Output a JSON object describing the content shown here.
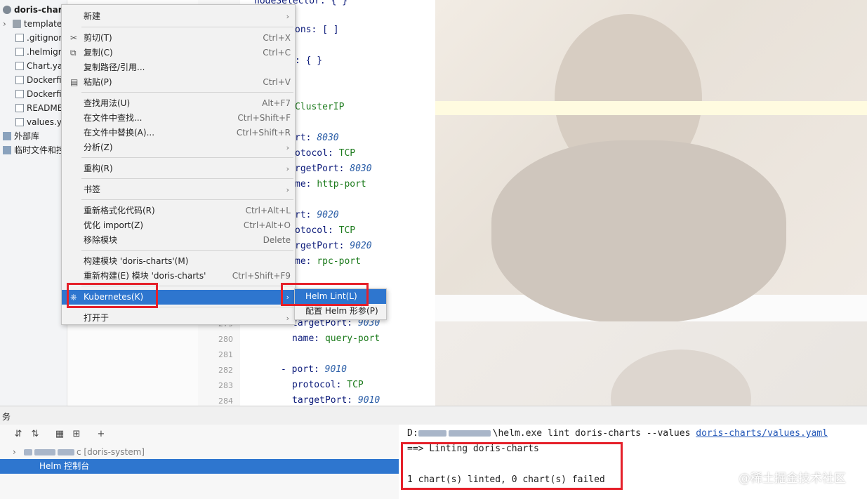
{
  "project_tree": {
    "root": "doris-charts",
    "items": [
      {
        "label": "templates",
        "icon": "folder-icon"
      },
      {
        "label": ".gitignore",
        "icon": "file-icon"
      },
      {
        "label": ".helmignore",
        "icon": "file-icon"
      },
      {
        "label": "Chart.yaml",
        "icon": "file-icon"
      },
      {
        "label": "Dockerfile",
        "icon": "file-icon"
      },
      {
        "label": "Dockerfile",
        "icon": "file-icon"
      },
      {
        "label": "README.md",
        "icon": "file-icon"
      },
      {
        "label": "values.yaml",
        "icon": "file-icon"
      }
    ],
    "external_libs": "外部库",
    "scratches": "临时文件和控制台"
  },
  "editor": {
    "lines_top": [
      {
        "text": "nodeSelector: { }",
        "kind": "key"
      },
      {
        "text": "ons: [ ]",
        "kind": "key"
      },
      {
        "text": ": { }",
        "kind": "key"
      },
      {
        "text": "ClusterIP",
        "kind": "str"
      },
      {
        "key": "rt: ",
        "val": "8030"
      },
      {
        "key": "otocol: ",
        "str": "TCP"
      },
      {
        "key": "rgetPort: ",
        "val": "8030"
      },
      {
        "key": "me: ",
        "str": "http-port"
      },
      {
        "key": "rt: ",
        "val": "9020"
      },
      {
        "key": "otocol: ",
        "str": "TCP"
      },
      {
        "key": "rgetPort: ",
        "val": "9020"
      },
      {
        "key": "me: ",
        "str": "rpc-port"
      }
    ],
    "gutter_numbers": [
      "279",
      "280",
      "281",
      "282",
      "283",
      "284"
    ],
    "lines_bottom": [
      {
        "key": "targetPort: ",
        "val": "9030"
      },
      {
        "key": "name: ",
        "str": "query-port"
      },
      {
        "key": "",
        "str": ""
      },
      {
        "key": "- port: ",
        "val": "9010"
      },
      {
        "key": "protocol: ",
        "str": "TCP"
      },
      {
        "key": "targetPort: ",
        "val": "9010"
      }
    ]
  },
  "context_menu": {
    "items": [
      {
        "label": "新建",
        "shortcut": "",
        "arrow": true
      },
      {
        "label": "剪切(T)",
        "shortcut": "Ctrl+X",
        "icon": "scissors-icon"
      },
      {
        "label": "复制(C)",
        "shortcut": "Ctrl+C",
        "icon": "copy-icon"
      },
      {
        "label": "复制路径/引用...",
        "shortcut": ""
      },
      {
        "label": "粘贴(P)",
        "shortcut": "Ctrl+V",
        "icon": "paste-icon"
      },
      {
        "label": "查找用法(U)",
        "shortcut": "Alt+F7"
      },
      {
        "label": "在文件中查找...",
        "shortcut": "Ctrl+Shift+F"
      },
      {
        "label": "在文件中替换(A)...",
        "shortcut": "Ctrl+Shift+R"
      },
      {
        "label": "分析(Z)",
        "shortcut": "",
        "arrow": true
      },
      {
        "label": "重构(R)",
        "shortcut": "",
        "arrow": true
      },
      {
        "label": "书签",
        "shortcut": "",
        "arrow": true
      },
      {
        "label": "重新格式化代码(R)",
        "shortcut": "Ctrl+Alt+L"
      },
      {
        "label": "优化 import(Z)",
        "shortcut": "Ctrl+Alt+O"
      },
      {
        "label": "移除模块",
        "shortcut": "Delete"
      },
      {
        "label": "构建模块 'doris-charts'(M)",
        "shortcut": ""
      },
      {
        "label": "重新构建(E) 模块 'doris-charts'",
        "shortcut": "Ctrl+Shift+F9"
      },
      {
        "label": "Kubernetes(K)",
        "shortcut": "",
        "arrow": true,
        "icon": "kubernetes-icon"
      },
      {
        "label": "打开于",
        "shortcut": "",
        "arrow": true
      }
    ]
  },
  "submenu": {
    "items": [
      {
        "label": "Helm Lint(L)"
      },
      {
        "label": "配置 Helm 形参(P)"
      }
    ]
  },
  "bottom_panel": {
    "title": "务",
    "services": {
      "tree_item": "c [doris-system]",
      "selected": "Helm 控制台"
    },
    "console": {
      "command_prefix": "D:",
      "command_mid": "\\helm.exe lint doris-charts --values ",
      "command_link": "doris-charts/values.yaml",
      "line2": "==> Linting doris-charts",
      "line3": "",
      "line4": "1 chart(s) linted, 0 chart(s) failed"
    }
  },
  "watermark": "@稀土掘金技术社区",
  "colors": {
    "selection": "#2e76cf",
    "highlight_box": "#e5202a",
    "menu_bg": "#f2f2f2"
  }
}
